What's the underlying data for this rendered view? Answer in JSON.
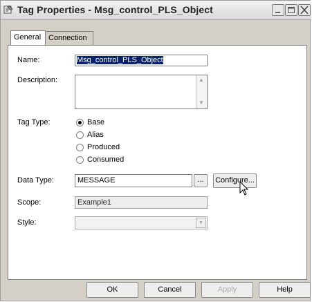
{
  "window": {
    "title": "Tag Properties - Msg_control_PLS_Object"
  },
  "tabs": [
    {
      "label": "General"
    },
    {
      "label": "Connection"
    }
  ],
  "form": {
    "name_label": "Name:",
    "name_value": "Msg_control_PLS_Object",
    "description_label": "Description:",
    "description_value": "",
    "tag_type_label": "Tag Type:",
    "tag_type_options": [
      "Base",
      "Alias",
      "Produced",
      "Consumed"
    ],
    "tag_type_selected": "Base",
    "data_type_label": "Data Type:",
    "data_type_value": "MESSAGE",
    "browse_label": "...",
    "configure_label": "Configure...",
    "scope_label": "Scope:",
    "scope_value": "Example1",
    "style_label": "Style:",
    "style_value": ""
  },
  "buttons": {
    "ok": "OK",
    "cancel": "Cancel",
    "apply": "Apply",
    "help": "Help"
  },
  "icons": {
    "title_icon": "tag-properties-icon",
    "minimize": "minimize-icon",
    "maximize": "maximize-icon",
    "close": "close-icon",
    "cursor": "mouse-pointer-icon"
  }
}
